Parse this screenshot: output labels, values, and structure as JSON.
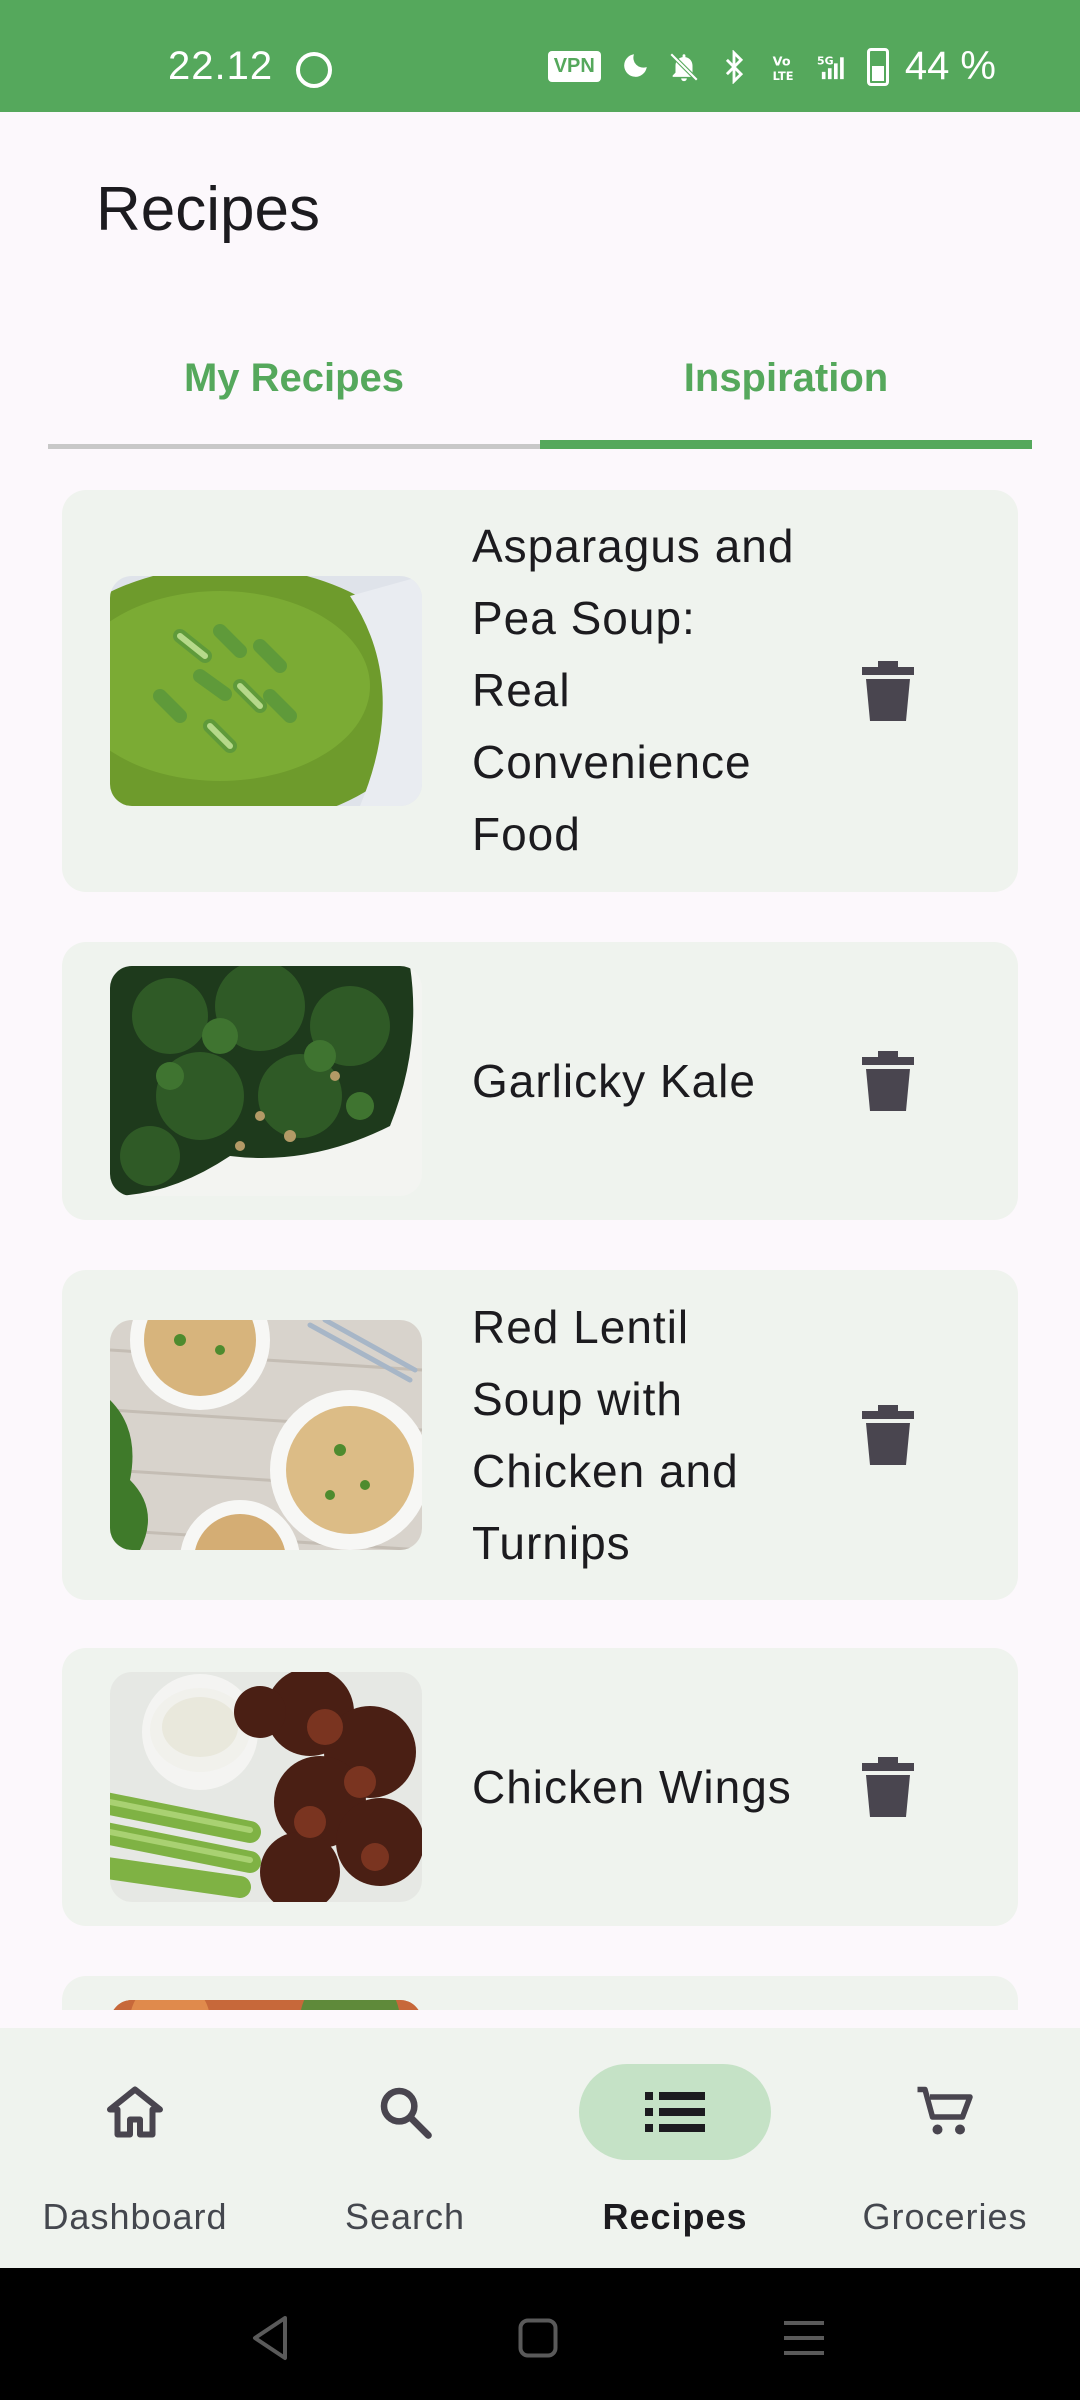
{
  "status_bar": {
    "time": "22.12",
    "vpn": "VPN",
    "battery": "44 %",
    "icons": [
      "whatsapp-icon",
      "moon-icon",
      "bell-off-icon",
      "bluetooth-icon",
      "volte-icon",
      "signal-5g-icon",
      "battery-icon"
    ],
    "background": "#55a85c"
  },
  "header": {
    "title": "Recipes"
  },
  "tabs": [
    {
      "label": "My Recipes",
      "selected": false
    },
    {
      "label": "Inspiration",
      "selected": true
    }
  ],
  "recipes": [
    {
      "title": "Asparagus and Pea Soup: Real Convenience Food",
      "image": "green-soup",
      "action_icon": "trash-icon"
    },
    {
      "title": "Garlicky Kale",
      "image": "kale",
      "action_icon": "trash-icon"
    },
    {
      "title": "Red Lentil Soup with Chicken and Turnips",
      "image": "lentil-soup",
      "action_icon": "trash-icon"
    },
    {
      "title": "Chicken Wings",
      "image": "chicken-wings",
      "action_icon": "trash-icon"
    }
  ],
  "bottom_nav": [
    {
      "label": "Dashboard",
      "icon": "home-icon",
      "selected": false
    },
    {
      "label": "Search",
      "icon": "search-icon",
      "selected": false
    },
    {
      "label": "Recipes",
      "icon": "list-icon",
      "selected": true
    },
    {
      "label": "Groceries",
      "icon": "cart-icon",
      "selected": false
    }
  ],
  "colors": {
    "accent": "#55a85c",
    "card": "#eff3ee",
    "nav_pill_active": "#c5e2c6",
    "icon": "#49454f"
  }
}
